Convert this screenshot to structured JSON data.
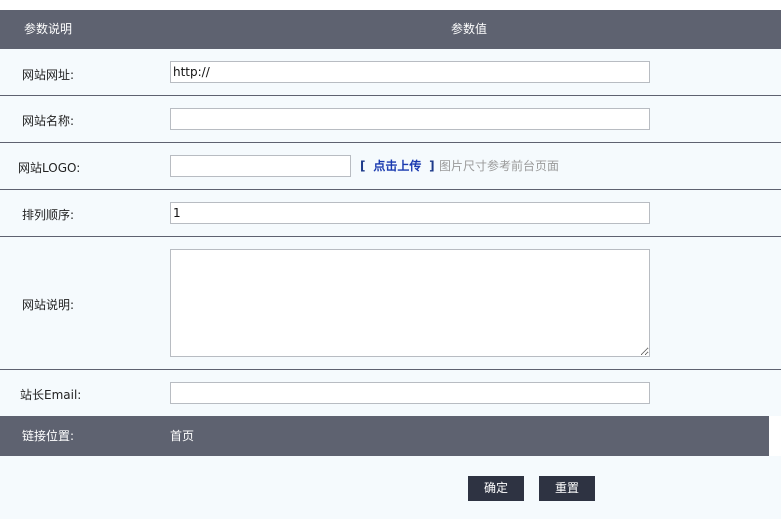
{
  "header": {
    "label_col": "参数说明",
    "value_col": "参数值"
  },
  "rows": {
    "site_url": {
      "label": "网站网址:",
      "value": "http://"
    },
    "site_name": {
      "label": "网站名称:",
      "value": ""
    },
    "site_logo": {
      "label": "网站LOGO:",
      "value": "",
      "upload_open": "[",
      "upload_text": "点击上传",
      "upload_close": "]",
      "hint": "图片尺寸参考前台页面"
    },
    "sort_order": {
      "label": "排列顺序:",
      "value": "1"
    },
    "site_desc": {
      "label": "网站说明:",
      "value": ""
    },
    "admin_email": {
      "label": "站长Email:",
      "value": ""
    }
  },
  "link_position": {
    "label": "链接位置:",
    "value": "首页"
  },
  "buttons": {
    "confirm": "确定",
    "reset": "重置"
  },
  "colors": {
    "header_bg": "#5e6270",
    "page_bg": "#f5fafd",
    "button_bg": "#2e3342",
    "link": "#1a3ab0"
  }
}
